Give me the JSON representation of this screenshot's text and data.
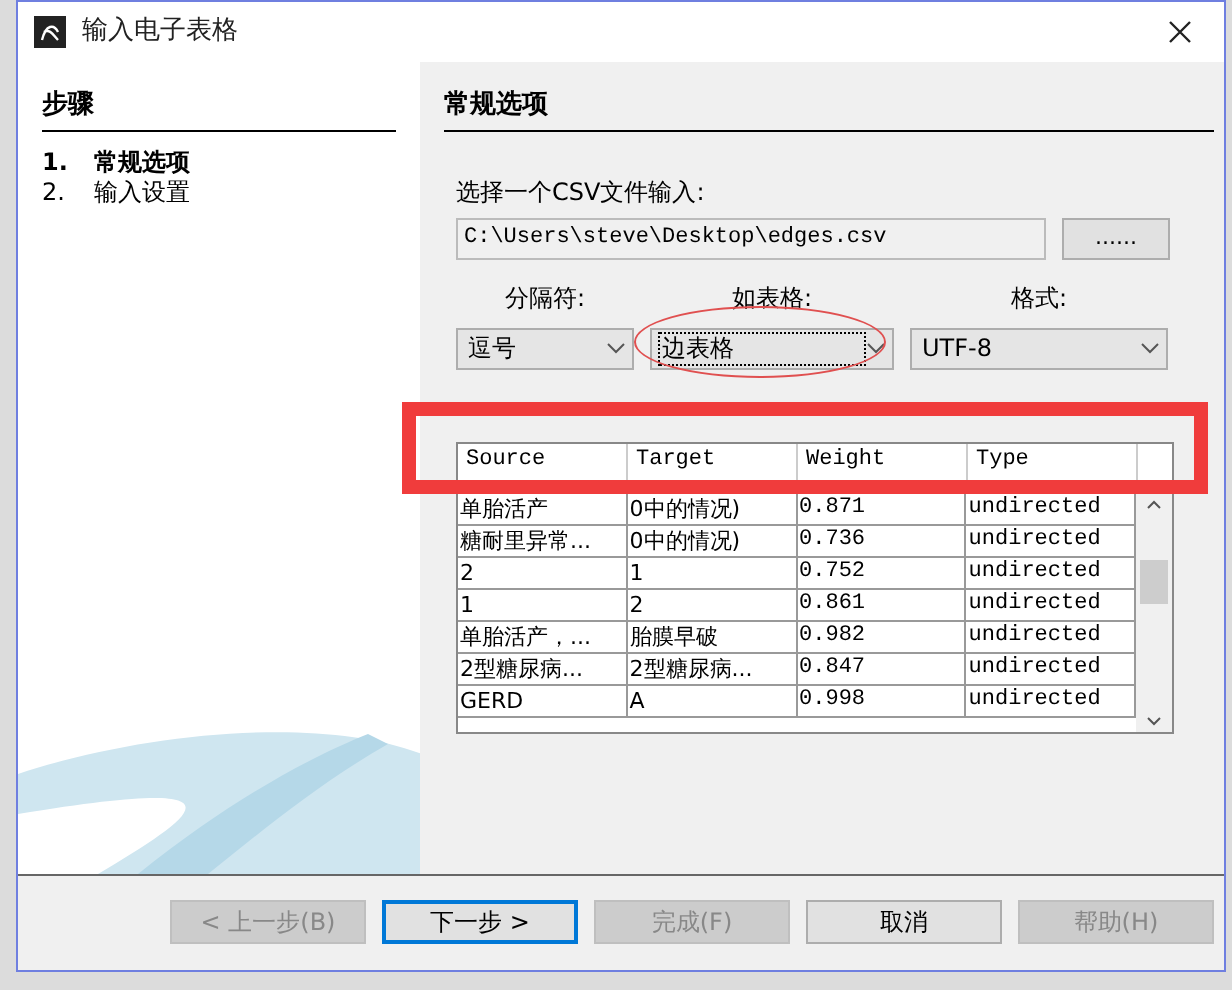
{
  "window": {
    "title": "输入电子表格"
  },
  "steps": {
    "title": "步骤",
    "items": [
      {
        "number": "1.",
        "label": "常规选项",
        "selected": true
      },
      {
        "number": "2.",
        "label": "输入设置",
        "selected": false
      }
    ]
  },
  "panel": {
    "title": "常规选项",
    "file_label": "选择一个CSV文件输入:",
    "file_path": "C:\\Users\\steve\\Desktop\\edges.csv",
    "browse_button": "......",
    "dropdowns": [
      {
        "label": "分隔符:",
        "value": "逗号",
        "focused": false
      },
      {
        "label": "如表格:",
        "value": "边表格",
        "focused": true
      },
      {
        "label": "格式:",
        "value": "UTF-8",
        "focused": false
      }
    ]
  },
  "preview": {
    "columns": [
      "Source",
      "Target",
      "Weight",
      "Type"
    ],
    "rows": [
      [
        "单胎活产",
        "0中的情况)",
        "0.871",
        "undirected"
      ],
      [
        "糖耐里异常...",
        "0中的情况)",
        "0.736",
        "undirected"
      ],
      [
        "2",
        "1",
        "0.752",
        "undirected"
      ],
      [
        "1",
        "2",
        "0.861",
        "undirected"
      ],
      [
        "单胎活产，...",
        "胎膜早破",
        "0.982",
        "undirected"
      ],
      [
        "2型糖尿病...",
        "2型糖尿病...",
        "0.847",
        "undirected"
      ],
      [
        "GERD",
        "A",
        "0.998",
        "undirected"
      ]
    ]
  },
  "buttons": [
    {
      "label": "< 上一步(B)",
      "disabled": true,
      "default": false
    },
    {
      "label": "下一步 >",
      "disabled": false,
      "default": true
    },
    {
      "label": "完成(F)",
      "disabled": true,
      "default": false
    },
    {
      "label": "取消",
      "disabled": false,
      "default": false
    },
    {
      "label": "帮助(H)",
      "disabled": true,
      "default": false
    }
  ],
  "annotations": [
    {
      "kind": "ellipse"
    },
    {
      "kind": "rectangle"
    }
  ]
}
